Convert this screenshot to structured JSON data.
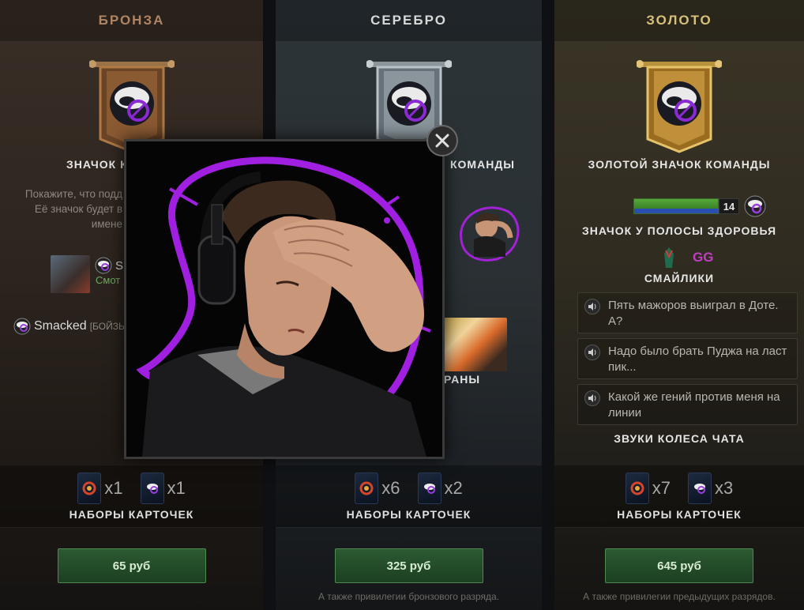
{
  "tiers": [
    {
      "name": "БРОНЗА",
      "badge_title": "ЗНАЧОК К",
      "description": "Покажите, что подд\nЕё значок будет в\nимене",
      "player_name_1": "Sr",
      "watch_label": "Смот",
      "player_name_2": "Smacked",
      "player_bracket": "[БОЙЗЬ",
      "pack_a_count": "x1",
      "pack_b_count": "x1",
      "packs_label": "НАБОРЫ КАРТОЧЕК",
      "price": "65 руб",
      "footnote": ""
    },
    {
      "name": "СЕРЕБРО",
      "badge_title": "КОМАНДЫ",
      "ranks_label": "РАНЫ",
      "pack_a_count": "x6",
      "pack_b_count": "x2",
      "packs_label": "НАБОРЫ КАРТОЧЕК",
      "price": "325 руб",
      "footnote": "А также привилегии бронзового разряда."
    },
    {
      "name": "ЗОЛОТО",
      "badge_title": "ЗОЛОТОЙ ЗНАЧОК КОМАНДЫ",
      "hp_level": "14",
      "hp_label": "ЗНАЧОК У ПОЛОСЫ ЗДОРОВЬЯ",
      "gg_text": "GG",
      "smiles_label": "СМАЙЛИКИ",
      "chat_lines": [
        "Пять мажоров выиграл в Доте. А?",
        "Надо было брать Пуджа на ласт пик...",
        "Какой же гений против меня на линии"
      ],
      "chat_label": "ЗВУКИ КОЛЕСА ЧАТА",
      "pack_a_count": "x7",
      "pack_b_count": "x3",
      "packs_label": "НАБОРЫ КАРТОЧЕК",
      "price": "645 руб",
      "footnote": "А также привилегии предыдущих разрядов."
    }
  ],
  "colors": {
    "bronze": "#b08463",
    "silver": "#d8d8d8",
    "gold": "#d6c07a",
    "accent_purple": "#c03ec0",
    "button_green": "#2c5a30"
  },
  "icons": {
    "banner_logo": "badger-logo-icon",
    "close": "close-icon",
    "speaker": "speaker-icon",
    "card_pack_a": "card-pack-team-icon",
    "card_pack_b": "card-pack-player-icon"
  }
}
